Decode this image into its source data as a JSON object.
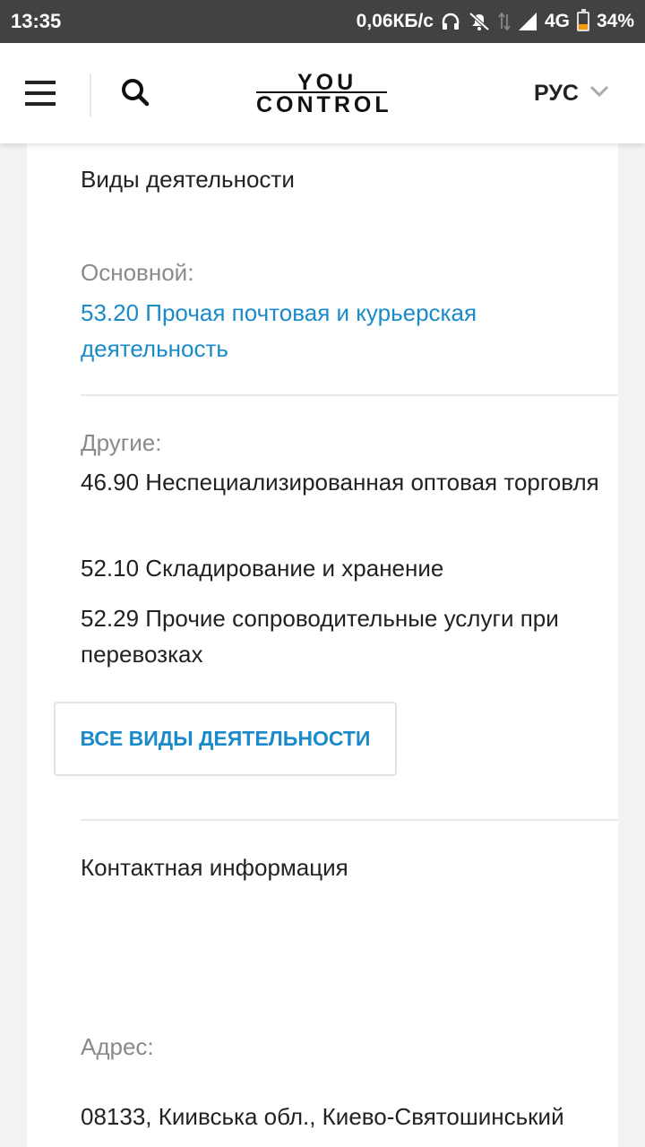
{
  "status_bar": {
    "time": "13:35",
    "network_speed": "0,06КБ/с",
    "network_type": "4G",
    "battery_percent": "34%",
    "battery_level": 0.34,
    "battery_color": "#f39c12",
    "icons": [
      "headphones-icon",
      "mute-icon",
      "data-arrows-icon",
      "signal-icon",
      "battery-icon"
    ]
  },
  "header": {
    "menu_icon": "hamburger-menu-icon",
    "search_icon": "search-icon",
    "logo_top": "YOU",
    "logo_bottom": "CONTROL",
    "language": "РУС",
    "language_icon": "chevron-down-icon"
  },
  "activities": {
    "section_title": "Виды деятельности",
    "main_label": "Основной:",
    "main_activity": "53.20 Прочая почтовая и курьерская деятельность",
    "other_label": "Другие:",
    "other_activities": [
      "46.90 Неспециализированная оптовая торговля",
      "52.10 Складирование и хранение",
      "52.29 Прочие сопроводительные услуги при перевозках"
    ],
    "all_button": "ВСЕ ВИДЫ ДЕЯТЕЛЬНОСТИ"
  },
  "contacts": {
    "section_title": "Контактная информация",
    "address_label": "Адрес:",
    "address_value": "08133, Киивська обл., Киево-Святошинський"
  },
  "colors": {
    "accent": "#1a8ac9",
    "muted_text": "#8a8a8a",
    "status_bar_bg": "#424242"
  }
}
